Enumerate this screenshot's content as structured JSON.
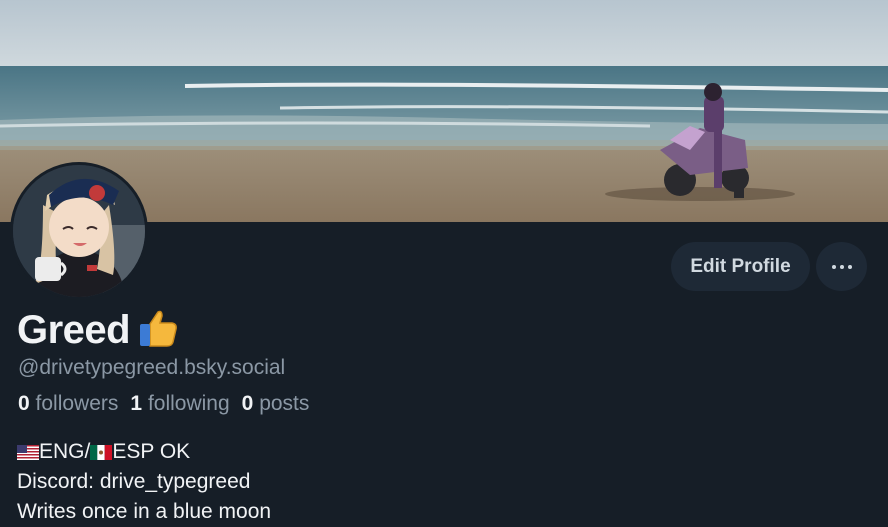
{
  "profile": {
    "display_name": "Greed",
    "name_emoji": "thumbs-up",
    "handle": "@drivetypegreed.bsky.social",
    "stats": {
      "followers_count": "0",
      "followers_label": "followers",
      "following_count": "1",
      "following_label": "following",
      "posts_count": "0",
      "posts_label": "posts"
    },
    "bio": {
      "line1_a": "ENG/",
      "line1_b": "ESP OK",
      "line2": "Discord: drive_typegreed",
      "line3": "Writes once in a blue moon"
    }
  },
  "actions": {
    "edit_label": "Edit Profile",
    "more_icon": "ellipsis-icon"
  },
  "colors": {
    "background": "#161e27",
    "button_bg": "#1e2936",
    "muted_text": "#8b98a5",
    "primary_text": "#f1f3f5"
  }
}
